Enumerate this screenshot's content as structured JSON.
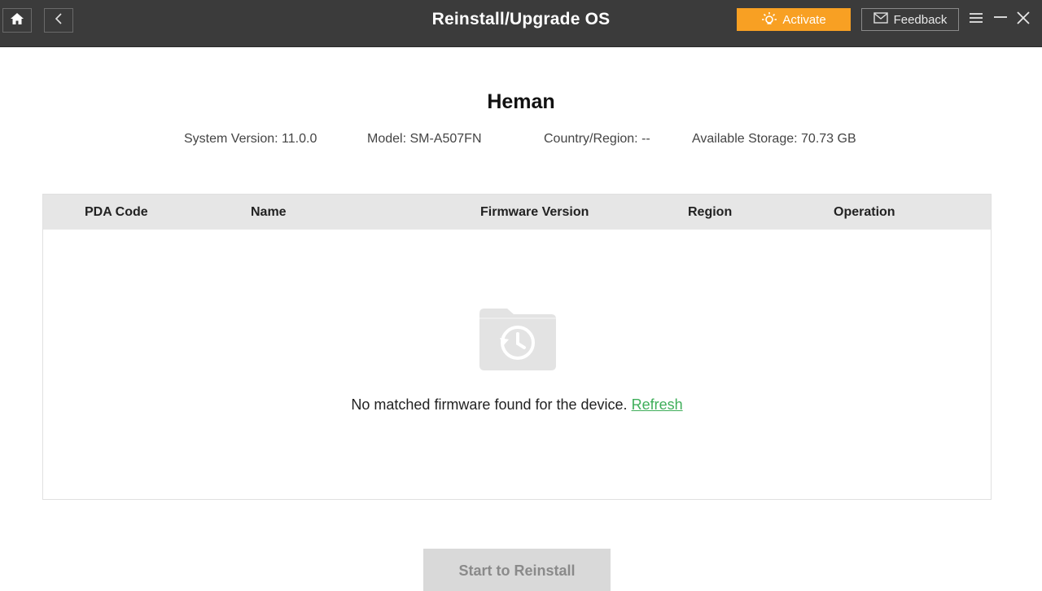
{
  "window": {
    "title": "Reinstall/Upgrade OS"
  },
  "toolbar": {
    "activate_label": "Activate",
    "feedback_label": "Feedback"
  },
  "device": {
    "name": "Heman",
    "system_version": "System Version: 11.0.0",
    "model": "Model: SM-A507FN",
    "country_region": "Country/Region: --",
    "available_storage": "Available Storage: 70.73 GB"
  },
  "table": {
    "columns": [
      "PDA Code",
      "Name",
      "Firmware Version",
      "Region",
      "Operation"
    ],
    "empty_message": "No matched firmware found for the device.",
    "refresh_label": "Refresh"
  },
  "actions": {
    "start_label": "Start to Reinstall"
  },
  "colors": {
    "titlebar": "#3b3b3b",
    "activate": "#f8a023",
    "refresh_link": "#3fae5a",
    "header_row": "#e6e6e6",
    "disabled_button": "#d9d9d9"
  },
  "icons": {
    "home": "home-icon",
    "back": "chevron-left-icon",
    "activate": "sun-icon",
    "feedback": "mail-icon",
    "menu": "hamburger-menu-icon",
    "minimize": "minimize-icon",
    "close": "close-icon",
    "empty": "folder-restore-icon"
  }
}
